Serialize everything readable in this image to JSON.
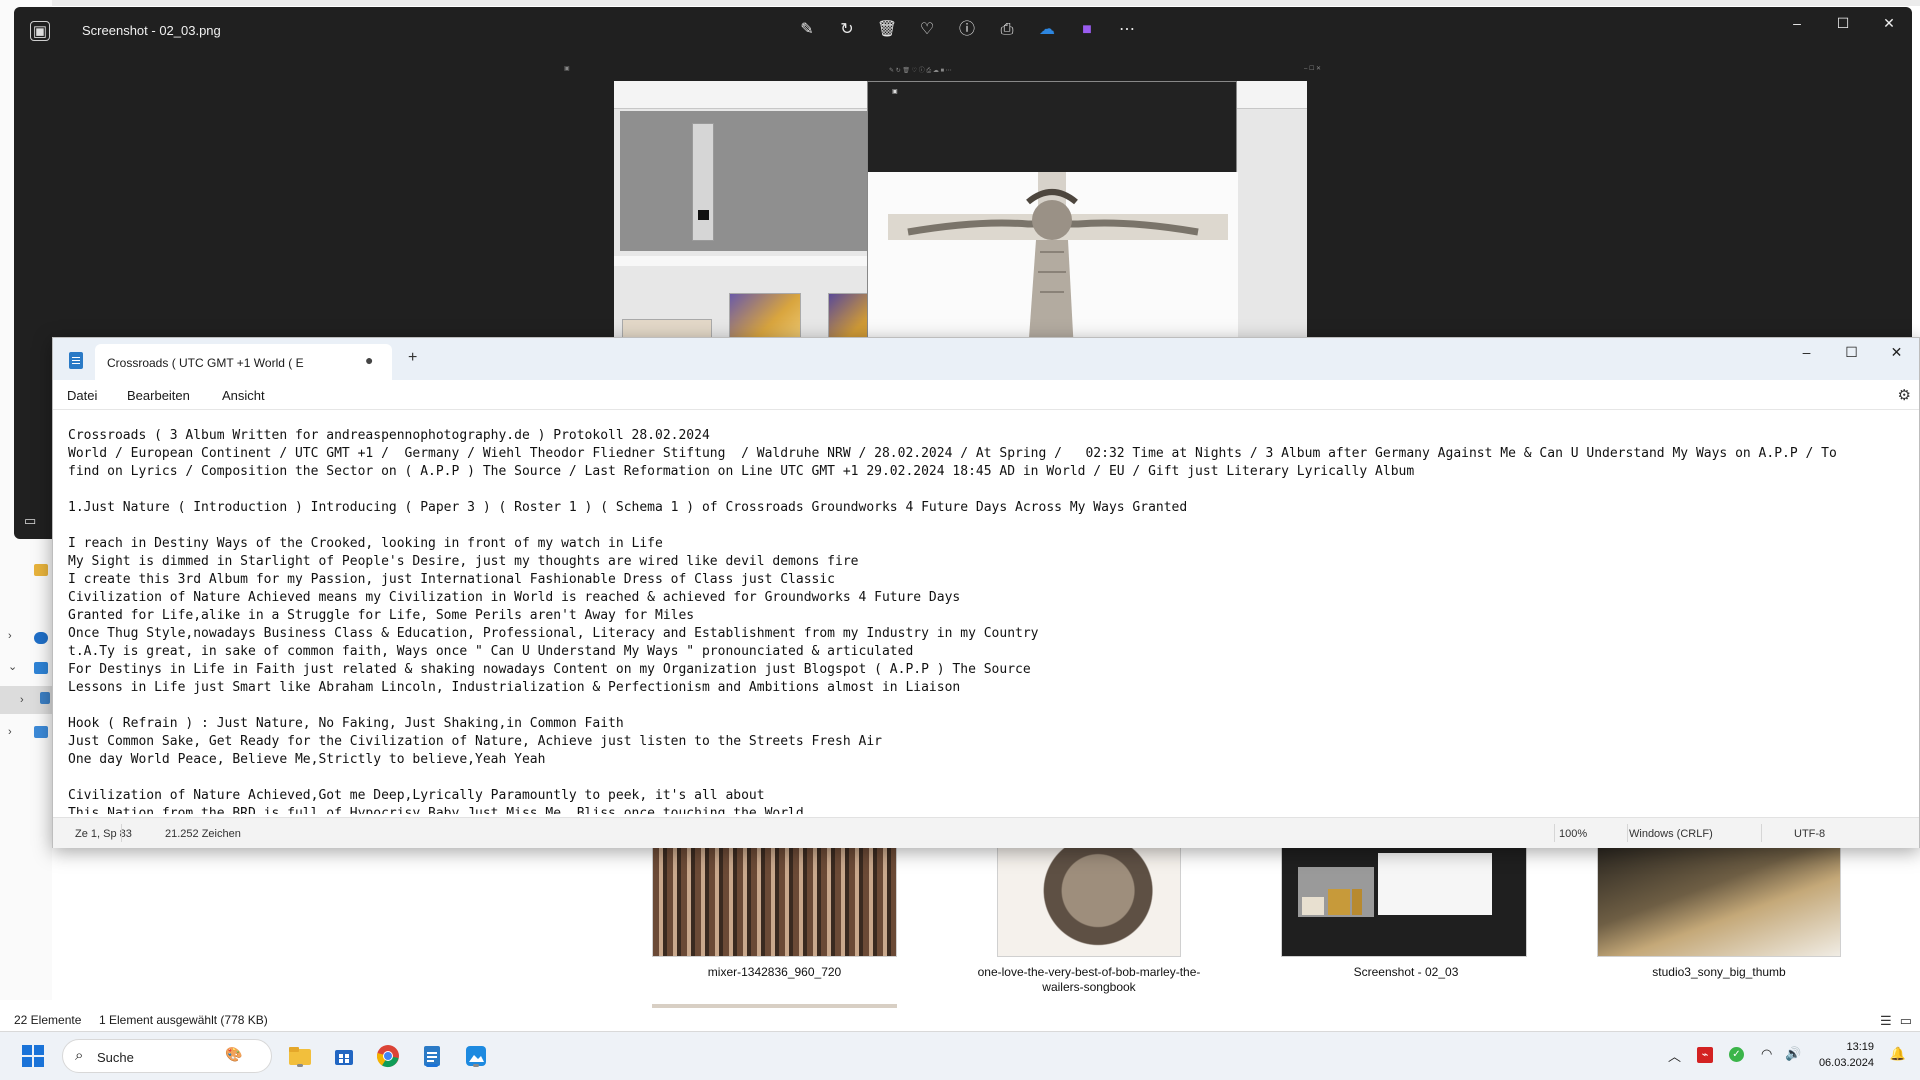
{
  "explorer": {
    "status_count": "22 Elemente",
    "status_selection": "1 Element ausgewählt (778 KB)",
    "thumbnails": [
      {
        "caption": "mixer-1342836_960_720"
      },
      {
        "caption": "one-love-the-very-best-of-bob-marley-the-wailers-songbook"
      },
      {
        "caption": "Screenshot - 02_03"
      },
      {
        "caption": "studio3_sony_big_thumb"
      }
    ]
  },
  "photos": {
    "title": "Screenshot - 02_03.png",
    "tools": [
      "edit-icon",
      "rotate-icon",
      "delete-icon",
      "favorite-icon",
      "info-icon",
      "print-icon",
      "onedrive-icon",
      "clipchamp-icon",
      "more-icon"
    ]
  },
  "notepad": {
    "tab_title": "Crossroads ( UTC GMT +1 World ( E",
    "menu": {
      "file": "Datei",
      "edit": "Bearbeiten",
      "view": "Ansicht"
    },
    "lines": [
      "Crossroads ( 3 Album Written for andreaspennophotography.de ) Protokoll 28.02.2024",
      "World / European Continent / UTC GMT +1 /  Germany / Wiehl Theodor Fliedner Stiftung  / Waldruhe NRW / 28.02.2024 / At Spring /   02:32 Time at Nights / 3 Album after Germany Against Me & Can U Understand My Ways on A.P.P / To",
      "find on Lyrics / Composition the Sector on ( A.P.P ) The Source / Last Reformation on Line UTC GMT +1 29.02.2024 18:45 AD in World / EU / Gift just Literary Lyrically Album",
      "",
      "1.Just Nature ( Introduction ) Introducing ( Paper 3 ) ( Roster 1 ) ( Schema 1 ) of Crossroads Groundworks 4 Future Days Across My Ways Granted",
      "",
      "I reach in Destiny Ways of the Crooked, looking in front of my watch in Life",
      "My Sight is dimmed in Starlight of People's Desire, just my thoughts are wired like devil demons fire",
      "I create this 3rd Album for my Passion, just International Fashionable Dress of Class just Classic",
      "Civilization of Nature Achieved means my Civilization in World is reached & achieved for Groundworks 4 Future Days",
      "Granted for Life,alike in a Struggle for Life, Some Perils aren't Away for Miles",
      "Once Thug Style,nowadays Business Class & Education, Professional, Literacy and Establishment from my Industry in my Country",
      "t.A.Ty is great, in sake of common faith, Ways once \" Can U Understand My Ways \" pronounciated & articulated",
      "For Destinys in Life in Faith just related & shaking nowadays Content on my Organization just Blogspot ( A.P.P ) The Source",
      "Lessons in Life just Smart like Abraham Lincoln, Industrialization & Perfectionism and Ambitions almost in Liaison",
      "",
      "Hook ( Refrain ) : Just Nature, No Faking, Just Shaking,in Common Faith",
      "Just Common Sake, Get Ready for the Civilization of Nature, Achieve just listen to the Streets Fresh Air",
      "One day World Peace, Believe Me,Strictly to believe,Yeah Yeah",
      "",
      "Civilization of Nature Achieved,Got me Deep,Lyrically Paramountly to peek, it's all about",
      "This Nation from the BRD is full of Hypocrisy Baby Just Miss Me, Bliss once touching the World"
    ],
    "status": {
      "position": "Ze 1, Sp 83",
      "chars": "21.252 Zeichen",
      "zoom": "100%",
      "line_ending": "Windows (CRLF)",
      "encoding": "UTF-8"
    }
  },
  "taskbar": {
    "search_label": "Suche",
    "time": "13:19",
    "date": "06.03.2024"
  },
  "colors": {
    "accent": "#1a73d8",
    "photos_bg": "#202020",
    "notepad_tabbar": "#eaf0f7"
  }
}
